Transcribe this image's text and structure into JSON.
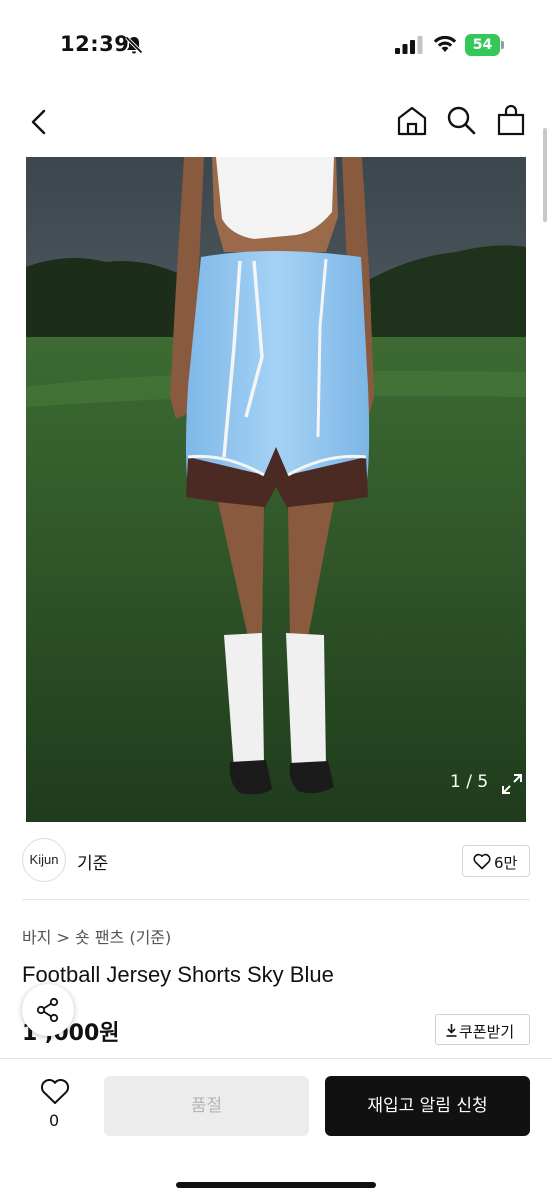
{
  "status": {
    "time": "12:39",
    "battery": "54"
  },
  "gallery": {
    "counter": "1 / 5"
  },
  "brand": {
    "logo_text": "Kijun",
    "name": "기준",
    "likes": "6만"
  },
  "product": {
    "breadcrumb": "바지 > 숏 팬츠 (기준)",
    "title": "Football Jersey Shorts Sky Blue",
    "price": "1  ,000원"
  },
  "actions": {
    "coupon_label": "쿠폰받기",
    "wish_count": "0",
    "soldout_label": "품절",
    "restock_label": "재입고 알림 신청"
  },
  "colors": {
    "accent": "#111111",
    "battery": "#34c759",
    "shorts": "#8ec5ef",
    "grass": "#2f5a2a"
  }
}
